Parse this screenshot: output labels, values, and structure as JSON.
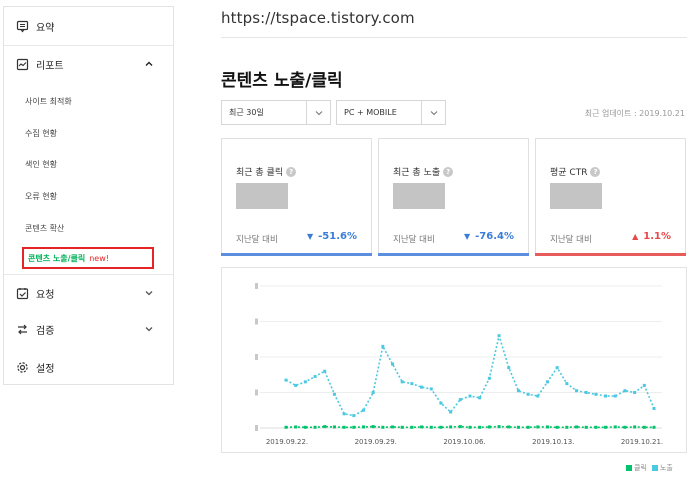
{
  "sidebar": {
    "summary": "요약",
    "report": "리포트",
    "report_items": [
      "사이트 최적화",
      "수집 현황",
      "색인 현황",
      "오류 현황",
      "콘텐츠 확산"
    ],
    "active_item": "콘텐츠 노출/클릭",
    "active_badge": "new!",
    "request": "요청",
    "verify": "검증",
    "settings": "설정"
  },
  "header": {
    "site_url": "https://tspace.tistory.com"
  },
  "page": {
    "title": "콘텐츠 노출/클릭"
  },
  "filters": {
    "period": "최근 30일",
    "device": "PC + MOBILE",
    "updated": "최근 업데이트 : 2019.10.21"
  },
  "cards": [
    {
      "title": "최근 총 클릭",
      "compare": "지난달 대비",
      "change": "-51.6%",
      "arrow": "▼",
      "trend": "down",
      "bar_color": "#5b8fde"
    },
    {
      "title": "최근 총 노출",
      "compare": "지난달 대비",
      "change": "-76.4%",
      "arrow": "▼",
      "trend": "down",
      "bar_color": "#5b8fde"
    },
    {
      "title": "평균 CTR",
      "compare": "지난달 대비",
      "change": "1.1%",
      "arrow": "▲",
      "trend": "up",
      "bar_color": "#e85b5b"
    }
  ],
  "colors": {
    "click": "#00c36b",
    "impression": "#4cc9e0",
    "down": "#3a7dd8",
    "up": "#e84848"
  },
  "chart_data": {
    "type": "line",
    "x_ticks": [
      "2019.09.22.",
      "2019.09.29.",
      "2019.10.06.",
      "2019.10.13.",
      "2019.10.21."
    ],
    "ylim": [
      0,
      4
    ],
    "y_gridlines": 4,
    "legend": [
      "클릭",
      "노출"
    ],
    "legend_position": "bottom-right",
    "series": [
      {
        "name": "노출",
        "values": [
          1.35,
          1.2,
          1.3,
          1.45,
          1.6,
          0.95,
          0.4,
          0.35,
          0.5,
          1.0,
          2.3,
          1.8,
          1.3,
          1.25,
          1.15,
          1.1,
          0.7,
          0.45,
          0.8,
          0.9,
          0.85,
          1.4,
          2.6,
          1.7,
          1.05,
          0.95,
          0.9,
          1.3,
          1.7,
          1.25,
          1.05,
          1.0,
          0.95,
          0.9,
          0.9,
          1.05,
          1.0,
          1.2,
          0.55
        ]
      },
      {
        "name": "클릭",
        "values": [
          0.02,
          0.03,
          0.02,
          0.02,
          0.04,
          0.03,
          0.02,
          0.02,
          0.03,
          0.04,
          0.02,
          0.03,
          0.02,
          0.02,
          0.03,
          0.02,
          0.02,
          0.03,
          0.04,
          0.02,
          0.02,
          0.03,
          0.04,
          0.03,
          0.02,
          0.02,
          0.03,
          0.03,
          0.02,
          0.02,
          0.03,
          0.02,
          0.02,
          0.02,
          0.03,
          0.02,
          0.03,
          0.02,
          0.02
        ]
      }
    ]
  }
}
